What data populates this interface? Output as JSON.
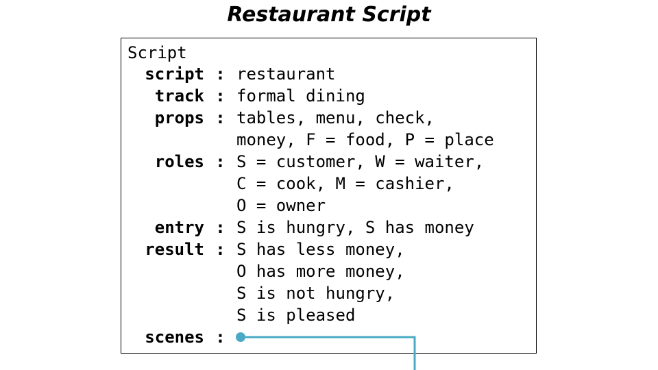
{
  "title": "Restaurant Script",
  "box_caption": "Script",
  "slots": [
    {
      "key": "script",
      "colon": ":",
      "lines": [
        "restaurant"
      ]
    },
    {
      "key": "track",
      "colon": ":",
      "lines": [
        "formal dining"
      ]
    },
    {
      "key": "props",
      "colon": ":",
      "lines": [
        "tables, menu, check,",
        "money, F = food, P = place"
      ]
    },
    {
      "key": "roles",
      "colon": ":",
      "lines": [
        "S = customer, W = waiter,",
        "C = cook, M = cashier,",
        "O = owner"
      ]
    },
    {
      "key": "entry",
      "colon": ":",
      "lines": [
        "S is hungry, S has money"
      ]
    },
    {
      "key": "result",
      "colon": ":",
      "lines": [
        "S has less money,",
        "O has more money,",
        "S is not hungry,",
        "S is pleased"
      ]
    },
    {
      "key": "scenes",
      "colon": ":",
      "lines": []
    }
  ],
  "colors": {
    "connector": "#4aaac6",
    "border": "#000000",
    "text": "#000000"
  }
}
